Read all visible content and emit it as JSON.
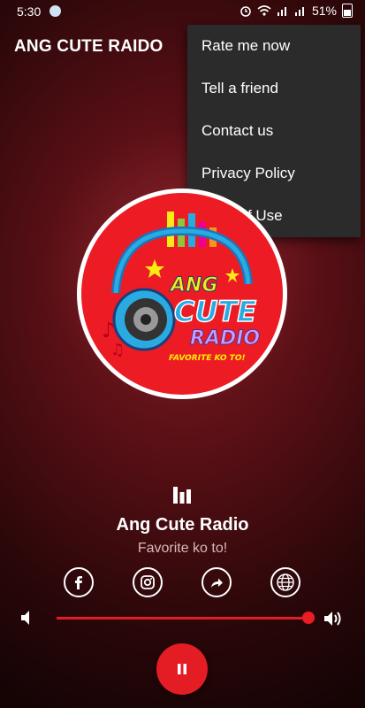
{
  "status_bar": {
    "time": "5:30",
    "battery": "51%"
  },
  "app_bar": {
    "title": "ANG CUTE RAIDO"
  },
  "menu": {
    "items": [
      {
        "label": "Rate me now"
      },
      {
        "label": "Tell a friend"
      },
      {
        "label": "Contact us"
      },
      {
        "label": "Privacy Policy"
      },
      {
        "label": "Term of Use"
      }
    ]
  },
  "logo": {
    "line1": "ANG",
    "line2": "CUTE",
    "line3": "RADIO",
    "slogan": "FAVORITE KO TO!"
  },
  "player": {
    "station_name": "Ang Cute Radio",
    "tagline": "Favorite ko to!",
    "volume": 1.0,
    "state": "playing",
    "icons": [
      "facebook-icon",
      "instagram-icon",
      "share-icon",
      "globe-icon"
    ]
  },
  "colors": {
    "accent": "#e41c24",
    "menu_bg": "#2b2b2b",
    "background": "#5a1016"
  }
}
